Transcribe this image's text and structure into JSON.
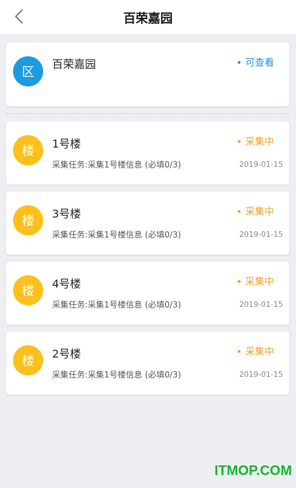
{
  "header": {
    "title": "百荣嘉园"
  },
  "community": {
    "avatar_char": "区",
    "name": "百荣嘉园",
    "status": "可查看",
    "status_color": "#2f8fdc",
    "avatar_color": "#1e9ae3"
  },
  "buildings": [
    {
      "avatar_char": "楼",
      "name": "1号楼",
      "status": "采集中",
      "task": "采集任务:采集1号楼信息 (必填0/3)",
      "date": "2019-01-15"
    },
    {
      "avatar_char": "楼",
      "name": "3号楼",
      "status": "采集中",
      "task": "采集任务:采集1号楼信息 (必填0/3)",
      "date": "2019-01-15"
    },
    {
      "avatar_char": "楼",
      "name": "4号楼",
      "status": "采集中",
      "task": "采集任务:采集1号楼信息 (必填0/3)",
      "date": "2019-01-15"
    },
    {
      "avatar_char": "楼",
      "name": "2号楼",
      "status": "采集中",
      "task": "采集任务:采集1号楼信息 (必填0/3)",
      "date": "2019-01-15"
    }
  ],
  "colors": {
    "building_avatar": "#fbc01b",
    "collecting_status": "#f0a020"
  },
  "watermark": "ITMOP.COM"
}
